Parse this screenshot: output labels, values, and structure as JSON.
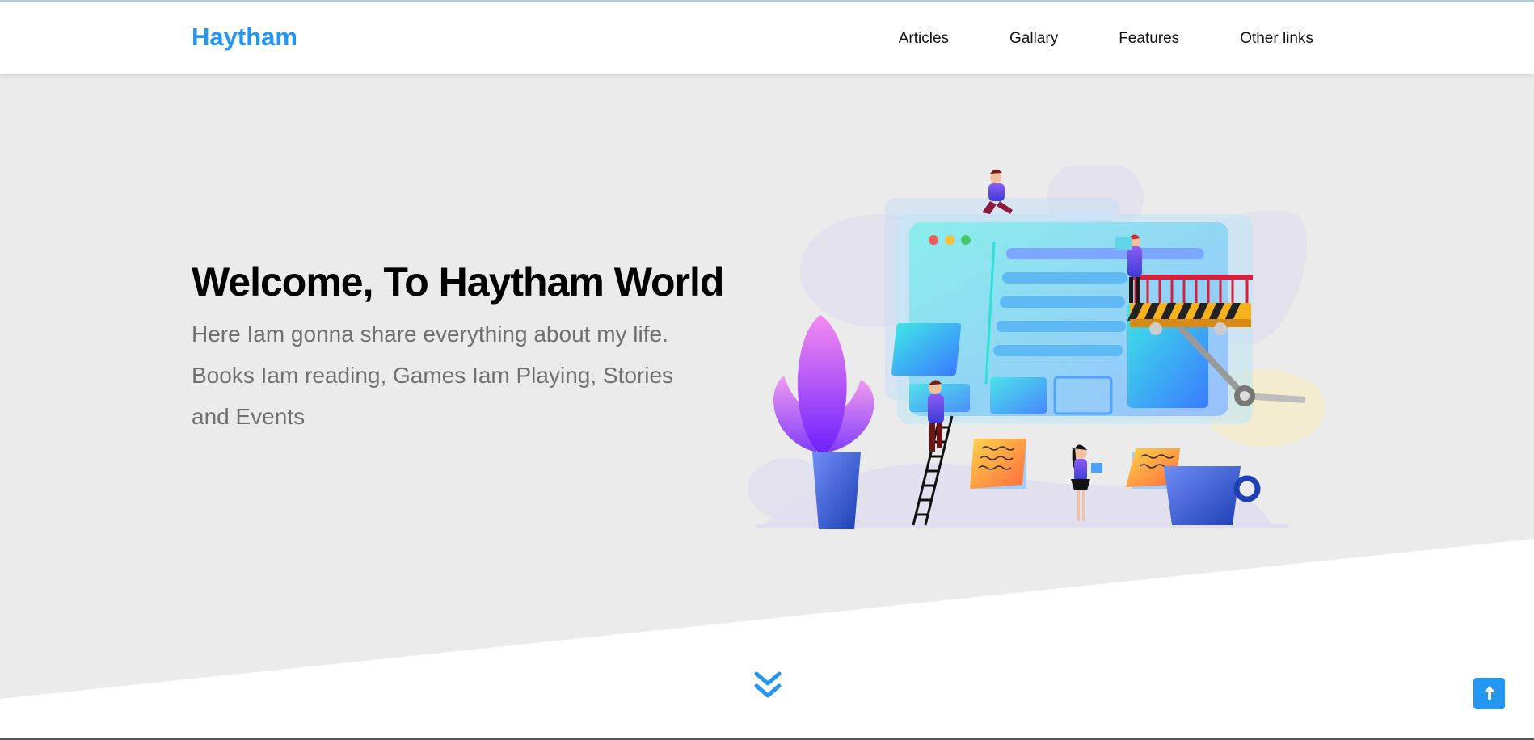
{
  "brand": {
    "name": "Haytham",
    "color": "#2196f3"
  },
  "nav": {
    "links": [
      {
        "label": "Articles"
      },
      {
        "label": "Gallary"
      },
      {
        "label": "Features"
      },
      {
        "label": "Other links"
      }
    ]
  },
  "hero": {
    "title": "Welcome, To Haytham World",
    "description": "Here Iam gonna share everything about my life. Books Iam reading, Games Iam Playing, Stories and Events",
    "background": "#ebebeb",
    "illustration": "website-construction-illustration"
  },
  "controls": {
    "scroll_down_icon": "double-chevron-down-icon",
    "scroll_top_icon": "arrow-up-icon"
  },
  "colors": {
    "accent": "#2196f3",
    "text": "#000000",
    "muted": "#707070"
  }
}
